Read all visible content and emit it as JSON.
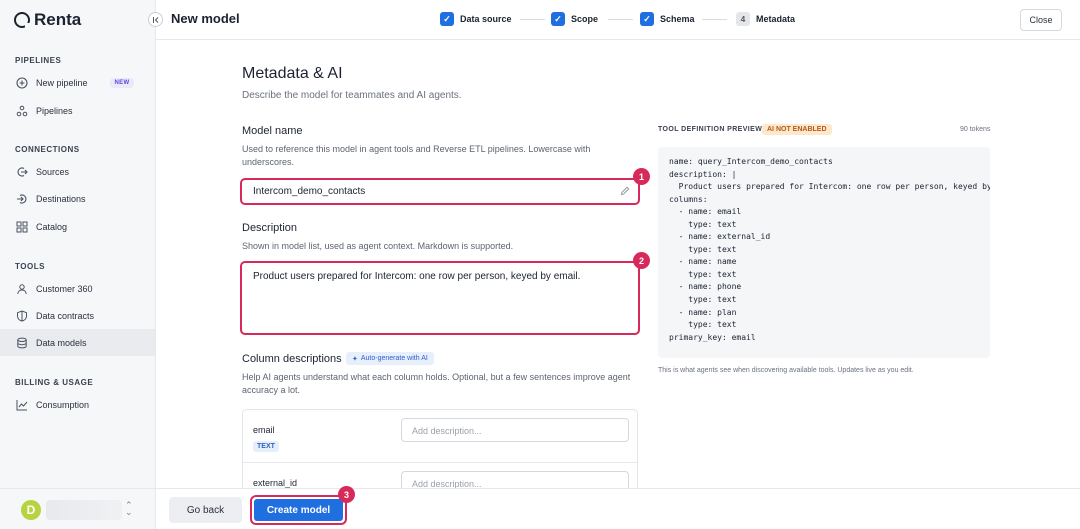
{
  "app": {
    "brand": "Renta",
    "page_title": "New model"
  },
  "steps": [
    {
      "label": "Data source",
      "state": "done"
    },
    {
      "label": "Scope",
      "state": "done"
    },
    {
      "label": "Schema",
      "state": "done"
    },
    {
      "label": "Metadata",
      "number": "4",
      "state": "current"
    }
  ],
  "close_label": "Close",
  "sidebar": {
    "sections": [
      {
        "title": "PIPELINES"
      },
      {
        "title": "CONNECTIONS"
      },
      {
        "title": "TOOLS"
      },
      {
        "title": "BILLING & USAGE"
      }
    ],
    "items": [
      {
        "label": "New pipeline",
        "badge": "NEW",
        "icon": "plus-circle-icon"
      },
      {
        "label": "Pipelines",
        "icon": "pipeline-icon"
      },
      {
        "label": "Sources",
        "icon": "source-icon"
      },
      {
        "label": "Destinations",
        "icon": "destination-icon"
      },
      {
        "label": "Catalog",
        "icon": "grid-icon"
      },
      {
        "label": "Customer 360",
        "icon": "user-icon"
      },
      {
        "label": "Data contracts",
        "icon": "shield-icon"
      },
      {
        "label": "Data models",
        "icon": "database-icon",
        "active": true
      },
      {
        "label": "Consumption",
        "icon": "chart-icon"
      }
    ],
    "avatar_letter": "D"
  },
  "form": {
    "heading": "Metadata & AI",
    "subheading": "Describe the model for teammates and AI agents.",
    "model_name": {
      "label": "Model name",
      "hint": "Used to reference this model in agent tools and Reverse ETL pipelines. Lowercase with underscores.",
      "value": "Intercom_demo_contacts"
    },
    "description": {
      "label": "Description",
      "hint": "Shown in model list, used as agent context. Markdown is supported.",
      "value": "Product users prepared for Intercom: one row per person, keyed by email."
    },
    "columns": {
      "label": "Column descriptions",
      "ai_button": "Auto-generate with AI",
      "hint": "Help AI agents understand what each column holds. Optional, but a few sentences improve agent accuracy a lot.",
      "rows": [
        {
          "name": "email",
          "type": "TEXT",
          "placeholder": "Add description..."
        },
        {
          "name": "external_id",
          "placeholder": "Add description..."
        }
      ]
    }
  },
  "markers": [
    "1",
    "2",
    "3"
  ],
  "preview": {
    "title": "TOOL DEFINITION PREVIEW",
    "status": "AI NOT ENABLED",
    "tokens": "90 tokens",
    "code": "name: query_Intercom_demo_contacts\ndescription: |\n  Product users prepared for Intercom: one row per person, keyed by\ncolumns:\n  - name: email\n    type: text\n  - name: external_id\n    type: text\n  - name: name\n    type: text\n  - name: phone\n    type: text\n  - name: plan\n    type: text\nprimary_key: email",
    "footnote": "This is what agents see when discovering available tools. Updates live as you edit."
  },
  "footer": {
    "back_label": "Go back",
    "create_label": "Create model"
  },
  "colors": {
    "accent": "#1f6fe0",
    "highlight": "#d82a5a"
  }
}
